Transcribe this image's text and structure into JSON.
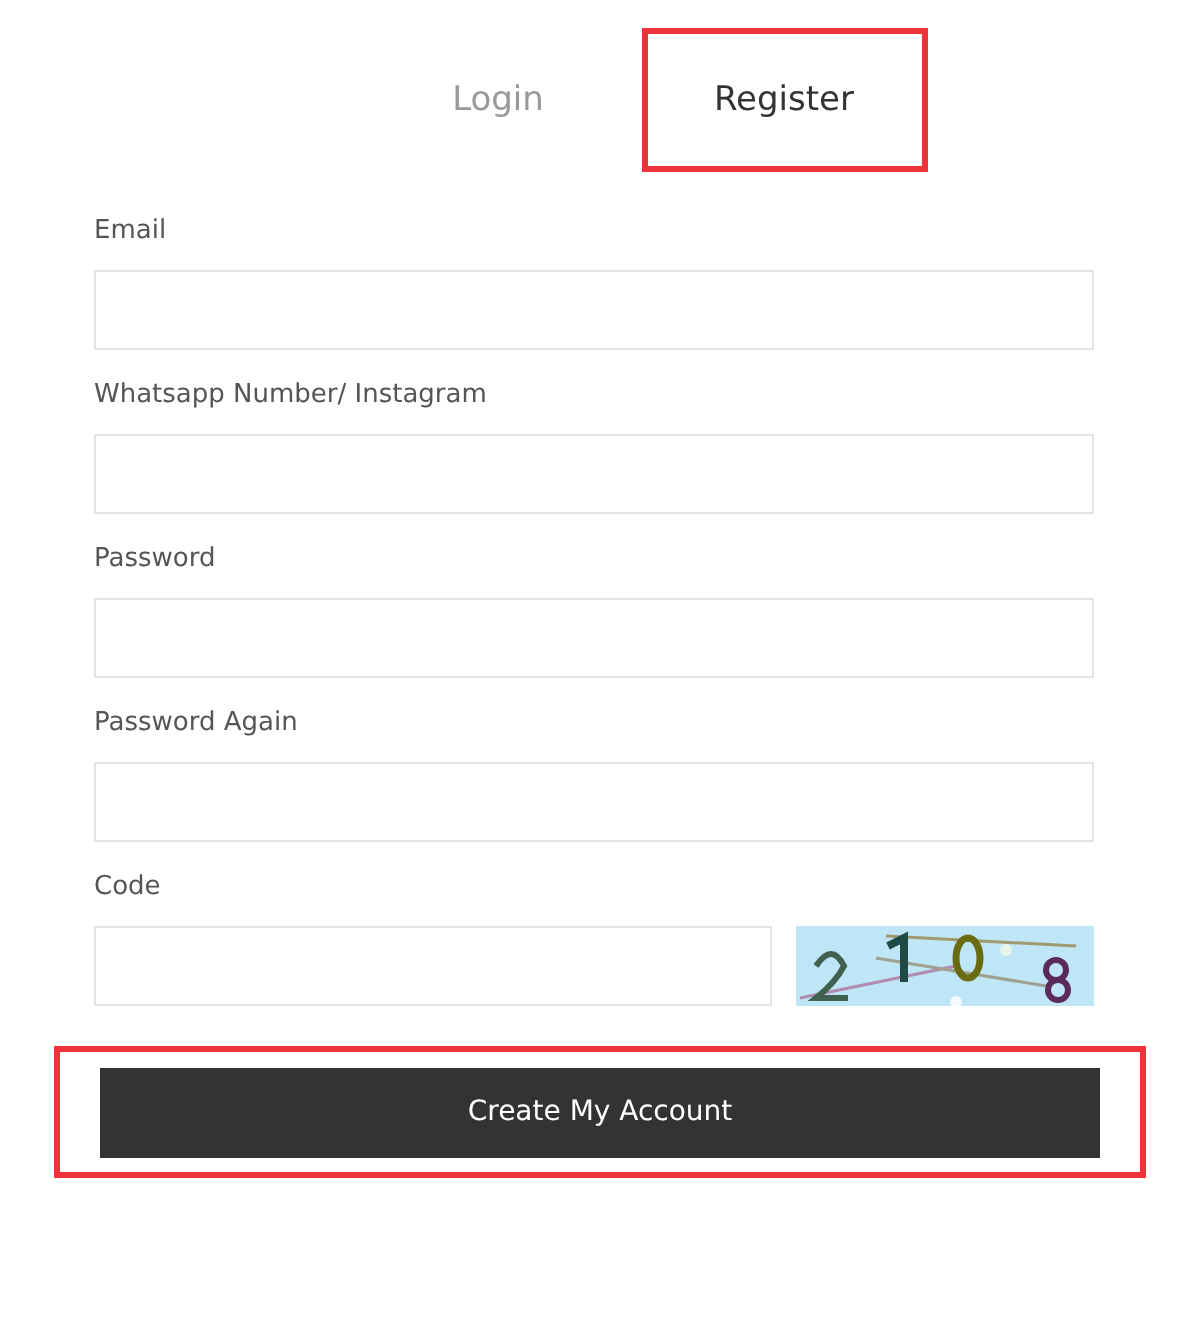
{
  "tabs": [
    {
      "label": "Login",
      "selected": false,
      "highlighted": false
    },
    {
      "label": "Register",
      "selected": true,
      "highlighted": true
    }
  ],
  "fields": [
    {
      "label": "Email",
      "kind": "text"
    },
    {
      "label": "Whatsapp Number/ Instagram",
      "kind": "text"
    },
    {
      "label": "Password",
      "kind": "text"
    },
    {
      "label": "Password Again",
      "kind": "text"
    },
    {
      "label": "Code",
      "kind": "captcha"
    }
  ],
  "submit": {
    "label": "Create My Account",
    "highlighted": true
  }
}
